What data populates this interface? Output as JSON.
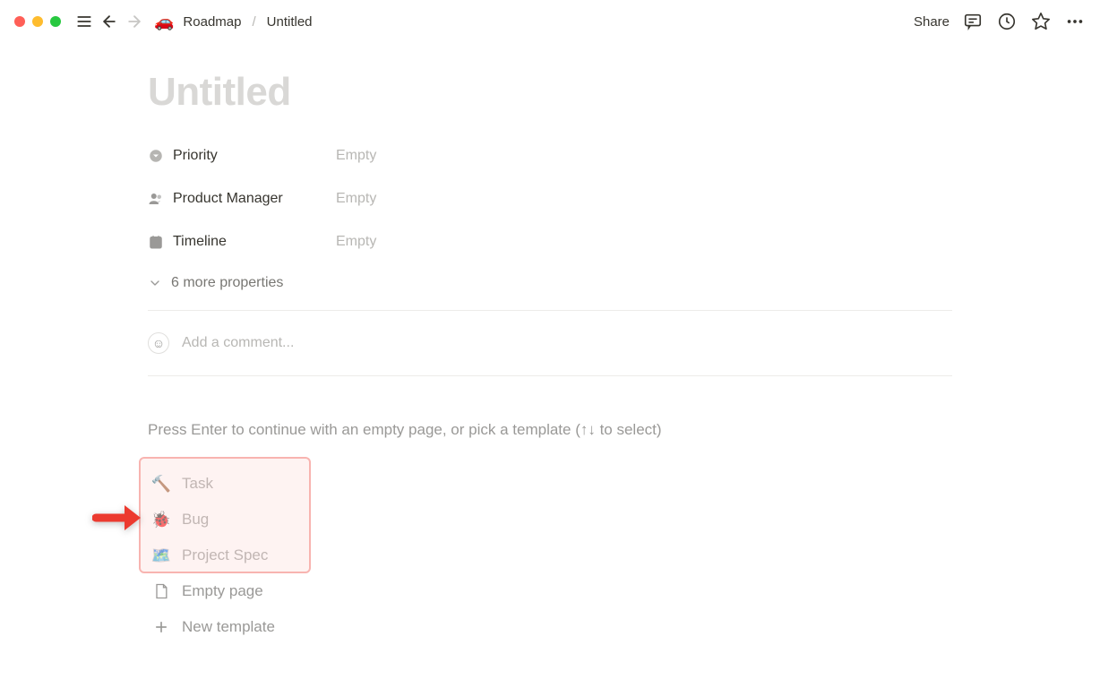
{
  "topbar": {
    "breadcrumb": {
      "parent_emoji": "🚗",
      "parent_label": "Roadmap",
      "current_label": "Untitled"
    },
    "share_label": "Share"
  },
  "page": {
    "title_placeholder": "Untitled"
  },
  "properties": [
    {
      "icon": "select",
      "label": "Priority",
      "value": "Empty"
    },
    {
      "icon": "person",
      "label": "Product Manager",
      "value": "Empty"
    },
    {
      "icon": "date",
      "label": "Timeline",
      "value": "Empty"
    }
  ],
  "more_properties_label": "6 more properties",
  "comment_placeholder": "Add a comment...",
  "template_hint": "Press Enter to continue with an empty page, or pick a template (↑↓ to select)",
  "templates": [
    {
      "emoji": "🔨",
      "label": "Task"
    },
    {
      "emoji": "🐞",
      "label": "Bug"
    },
    {
      "emoji": "🗺️",
      "label": "Project Spec"
    }
  ],
  "empty_page_label": "Empty page",
  "new_template_label": "New template",
  "annotation": {
    "highlight_color": "#f8b4b0",
    "arrow_color": "#ec3a2f"
  }
}
